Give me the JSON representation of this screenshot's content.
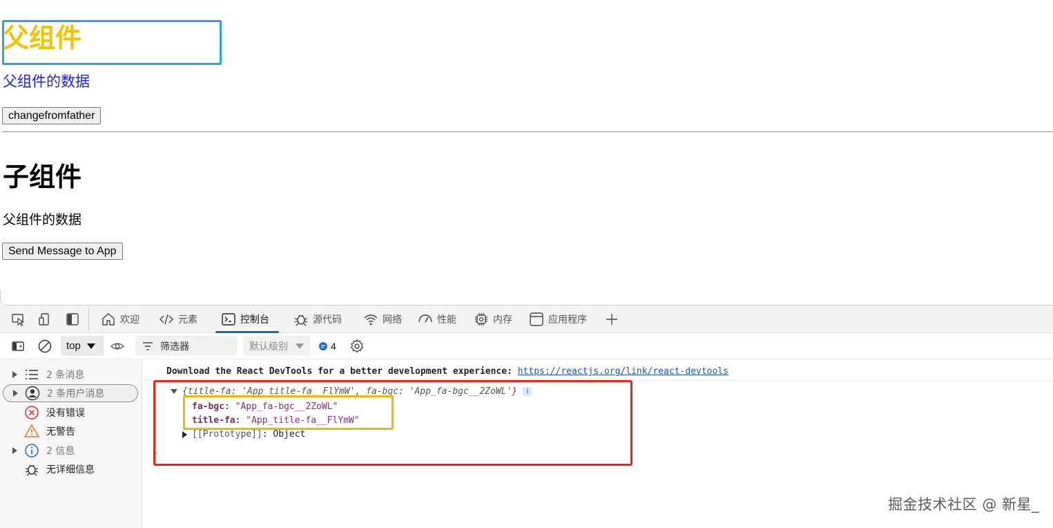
{
  "page": {
    "parent_title": "父组件",
    "parent_data": "父组件的数据",
    "change_button": "changefromfather",
    "child_title": "子组件",
    "child_data": "父组件的数据",
    "send_button": "Send Message to App"
  },
  "devtools": {
    "tabs": [
      {
        "label": "欢迎",
        "icon": "home-icon"
      },
      {
        "label": "元素",
        "icon": "code-icon"
      },
      {
        "label": "控制台",
        "icon": "console-icon"
      },
      {
        "label": "源代码",
        "icon": "bug-icon"
      },
      {
        "label": "网络",
        "icon": "wifi-icon"
      },
      {
        "label": "性能",
        "icon": "gauge-icon"
      },
      {
        "label": "内存",
        "icon": "chip-icon"
      },
      {
        "label": "应用程序",
        "icon": "window-icon"
      }
    ],
    "active_tab": "控制台",
    "toolbar": {
      "context": "top",
      "filter_placeholder": "筛选器",
      "level": "默认级别",
      "issues_count": "4"
    },
    "sidebar": [
      {
        "label": "2 条消息",
        "icon": "list-icon"
      },
      {
        "label": "2 条用户消息",
        "icon": "user-icon"
      },
      {
        "label": "没有错误",
        "icon": "error-icon"
      },
      {
        "label": "无警告",
        "icon": "warning-icon"
      },
      {
        "label": "2 信息",
        "icon": "info-icon"
      },
      {
        "label": "无详细信息",
        "icon": "bug-icon"
      }
    ],
    "console": {
      "message_text": "Download the React DevTools for a better development experience:",
      "message_link": "https://reactjs.org/link/react-devtools",
      "object_preview": "{title-fa: 'App_title-fa__FlYmW', fa-bgc: 'App_fa-bgc__2ZoWL'}",
      "props": [
        {
          "key": "fa-bgc",
          "value": "\"App_fa-bgc__2ZoWL\""
        },
        {
          "key": "title-fa",
          "value": "\"App_title-fa__FlYmW\""
        }
      ],
      "prototype_key": "[[Prototype]]",
      "prototype_value": "Object"
    }
  },
  "watermark": "掘金技术社区 @ 新星_",
  "colors": {
    "highlight_blue": "#2ea0e8",
    "title_yellow": "#f3c300",
    "link_blue": "#1d1df0",
    "annotation_red": "#e8261e",
    "annotation_yellow": "#f1b800",
    "tab_accent": "#0f6cbd"
  }
}
